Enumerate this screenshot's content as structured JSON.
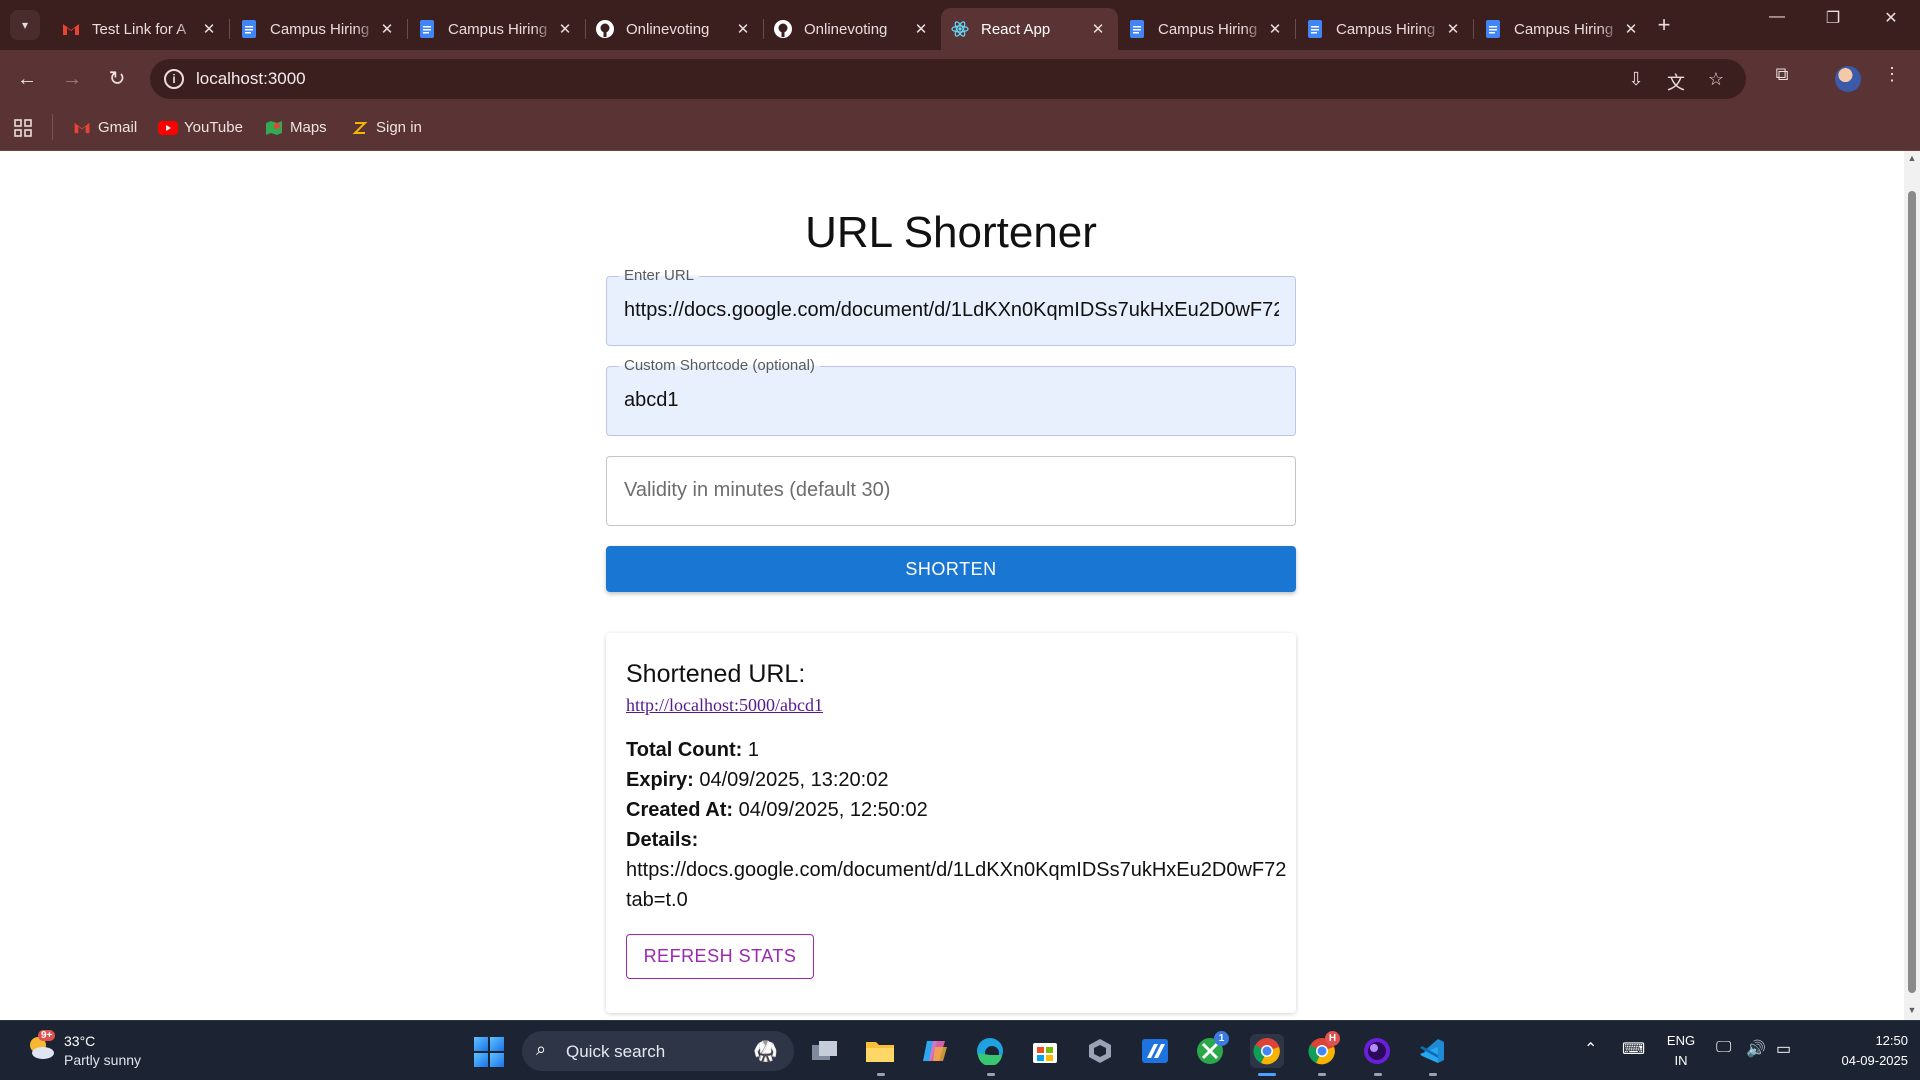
{
  "browser": {
    "tabs": [
      {
        "title": "Test Link for A",
        "icon": "gmail-icon",
        "active": false
      },
      {
        "title": "Campus Hiring",
        "icon": "google-docs-icon",
        "active": false
      },
      {
        "title": "Campus Hiring",
        "icon": "google-docs-icon",
        "active": false
      },
      {
        "title": "Onlinevoting",
        "icon": "github-icon",
        "active": false
      },
      {
        "title": "Onlinevoting",
        "icon": "github-icon",
        "active": false
      },
      {
        "title": "React App",
        "icon": "react-icon",
        "active": true
      },
      {
        "title": "Campus Hiring",
        "icon": "google-docs-icon",
        "active": false
      },
      {
        "title": "Campus Hiring",
        "icon": "google-docs-icon",
        "active": false
      },
      {
        "title": "Campus Hiring",
        "icon": "google-docs-icon",
        "active": false
      }
    ],
    "address": "localhost:3000",
    "bookmarks": [
      {
        "label": "Gmail",
        "icon": "gmail-icon"
      },
      {
        "label": "YouTube",
        "icon": "youtube-icon"
      },
      {
        "label": "Maps",
        "icon": "maps-icon"
      },
      {
        "label": "Sign in",
        "icon": "sign-in-icon"
      }
    ]
  },
  "app": {
    "title": "URL Shortener",
    "form": {
      "url_label": "Enter URL",
      "url_value": "https://docs.google.com/document/d/1LdKXn0KqmIDSs7ukHxEu2D0wF72",
      "shortcode_label": "Custom Shortcode (optional)",
      "shortcode_value": "abcd1",
      "validity_placeholder": "Validity in minutes (default 30)",
      "submit_label": "SHORTEN"
    },
    "result": {
      "heading": "Shortened URL:",
      "short_url": "http://localhost:5000/abcd1",
      "total_count_label": "Total Count:",
      "total_count": "1",
      "expiry_label": "Expiry:",
      "expiry": "04/09/2025, 13:20:02",
      "created_label": "Created At:",
      "created": "04/09/2025, 12:50:02",
      "details_label": "Details:",
      "details_line1": "https://docs.google.com/document/d/1LdKXn0KqmIDSs7ukHxEu2D0wF72",
      "details_line2": "tab=t.0",
      "refresh_label": "REFRESH STATS"
    }
  },
  "taskbar": {
    "weather_temp": "33°C",
    "weather_desc": "Partly sunny",
    "weather_badge": "9+",
    "search_placeholder": "Quick search",
    "xbox_badge": "1",
    "chrome_badge": "H",
    "language_line1": "ENG",
    "language_line2": "IN",
    "time": "12:50",
    "date": "04-09-2025"
  },
  "colors": {
    "chrome_dark": "#3b1f1f",
    "chrome_mid": "#5a3434",
    "primary": "#1976d2",
    "secondary": "#9c27b0",
    "link": "#551a8b",
    "taskbar": "#1c2433"
  }
}
